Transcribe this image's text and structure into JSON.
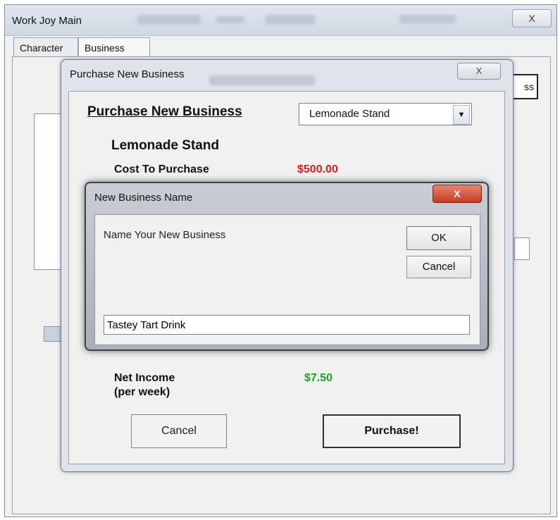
{
  "main_window": {
    "title": "Work Joy Main",
    "close_label": "X",
    "tabs": [
      {
        "label": "Character"
      },
      {
        "label": "Business"
      }
    ],
    "partial_button_text": "ss"
  },
  "purchase_dialog": {
    "title": "Purchase New Business",
    "close_label": "X",
    "heading": "Purchase New Business",
    "select_value": "Lemonade Stand",
    "business_title": "Lemonade Stand",
    "cost_label": "Cost To Purchase",
    "cost_value": "$500.00",
    "net_income_label_line1": "Net Income",
    "net_income_label_line2": "(per week)",
    "net_income_value": "$7.50",
    "cancel_label": "Cancel",
    "purchase_label": "Purchase!",
    "colors": {
      "cost": "#d42020",
      "income": "#22a022"
    }
  },
  "name_dialog": {
    "title": "New Business Name",
    "close_label": "X",
    "prompt": "Name Your New Business",
    "ok_label": "OK",
    "cancel_label": "Cancel",
    "input_value": "Tastey Tart Drink"
  }
}
